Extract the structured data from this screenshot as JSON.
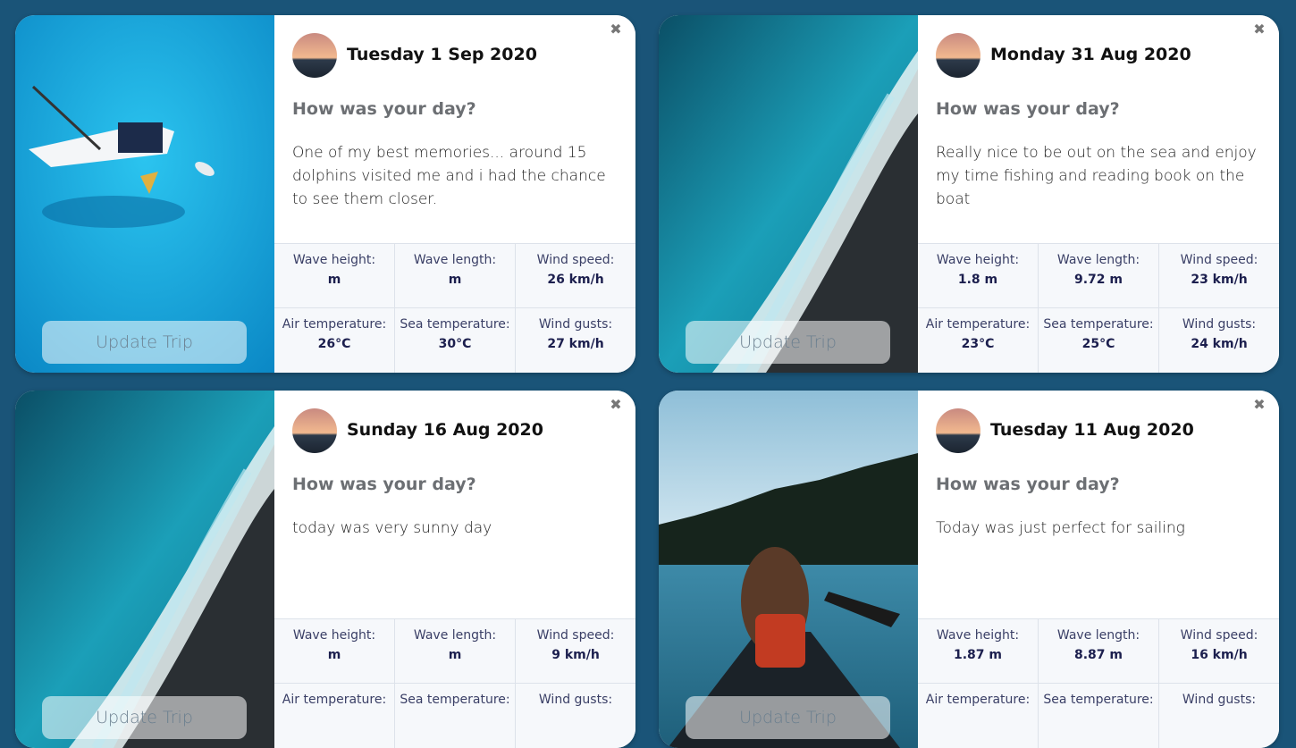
{
  "cards": [
    {
      "date": "Tuesday 1 Sep 2020",
      "question": "How was your day?",
      "story": "One of my best memories... around 15 dolphins visited me and i had the chance to see them closer.",
      "update_label": "Update Trip",
      "close_label": "✖",
      "photo": "sailboat-aerial",
      "stats": [
        {
          "label": "Wave height:",
          "value": "m"
        },
        {
          "label": "Wave length:",
          "value": "m"
        },
        {
          "label": "Wind speed:",
          "value": "26 km/h"
        },
        {
          "label": "Air temperature:",
          "value": "26°C"
        },
        {
          "label": "Sea temperature:",
          "value": "30°C"
        },
        {
          "label": "Wind gusts:",
          "value": "27 km/h"
        }
      ]
    },
    {
      "date": "Monday 31 Aug 2020",
      "question": "How was your day?",
      "story": "Really nice to be out on the sea and enjoy my time fishing and reading book on the boat",
      "update_label": "Update Trip",
      "close_label": "✖",
      "photo": "waves-shore-aerial",
      "stats": [
        {
          "label": "Wave height:",
          "value": "1.8 m"
        },
        {
          "label": "Wave length:",
          "value": "9.72 m"
        },
        {
          "label": "Wind speed:",
          "value": "23 km/h"
        },
        {
          "label": "Air temperature:",
          "value": "23°C"
        },
        {
          "label": "Sea temperature:",
          "value": "25°C"
        },
        {
          "label": "Wind gusts:",
          "value": "24 km/h"
        }
      ]
    },
    {
      "date": "Sunday 16 Aug 2020",
      "question": "How was your day?",
      "story": "today was very sunny day",
      "update_label": "Update Trip",
      "close_label": "✖",
      "photo": "waves-shore-aerial",
      "stats": [
        {
          "label": "Wave height:",
          "value": "m"
        },
        {
          "label": "Wave length:",
          "value": "m"
        },
        {
          "label": "Wind speed:",
          "value": "9 km/h"
        },
        {
          "label": "Air temperature:",
          "value": ""
        },
        {
          "label": "Sea temperature:",
          "value": ""
        },
        {
          "label": "Wind gusts:",
          "value": ""
        }
      ]
    },
    {
      "date": "Tuesday 11 Aug 2020",
      "question": "How was your day?",
      "story": "Today was just perfect for sailing",
      "update_label": "Update Trip",
      "close_label": "✖",
      "photo": "canoe-lake",
      "stats": [
        {
          "label": "Wave height:",
          "value": "1.87 m"
        },
        {
          "label": "Wave length:",
          "value": "8.87 m"
        },
        {
          "label": "Wind speed:",
          "value": "16 km/h"
        },
        {
          "label": "Air temperature:",
          "value": ""
        },
        {
          "label": "Sea temperature:",
          "value": ""
        },
        {
          "label": "Wind gusts:",
          "value": ""
        }
      ]
    }
  ],
  "colors": {
    "page_background": "#1a5478",
    "stat_background": "#f6f8fb",
    "stat_value": "#1c1f4e"
  }
}
